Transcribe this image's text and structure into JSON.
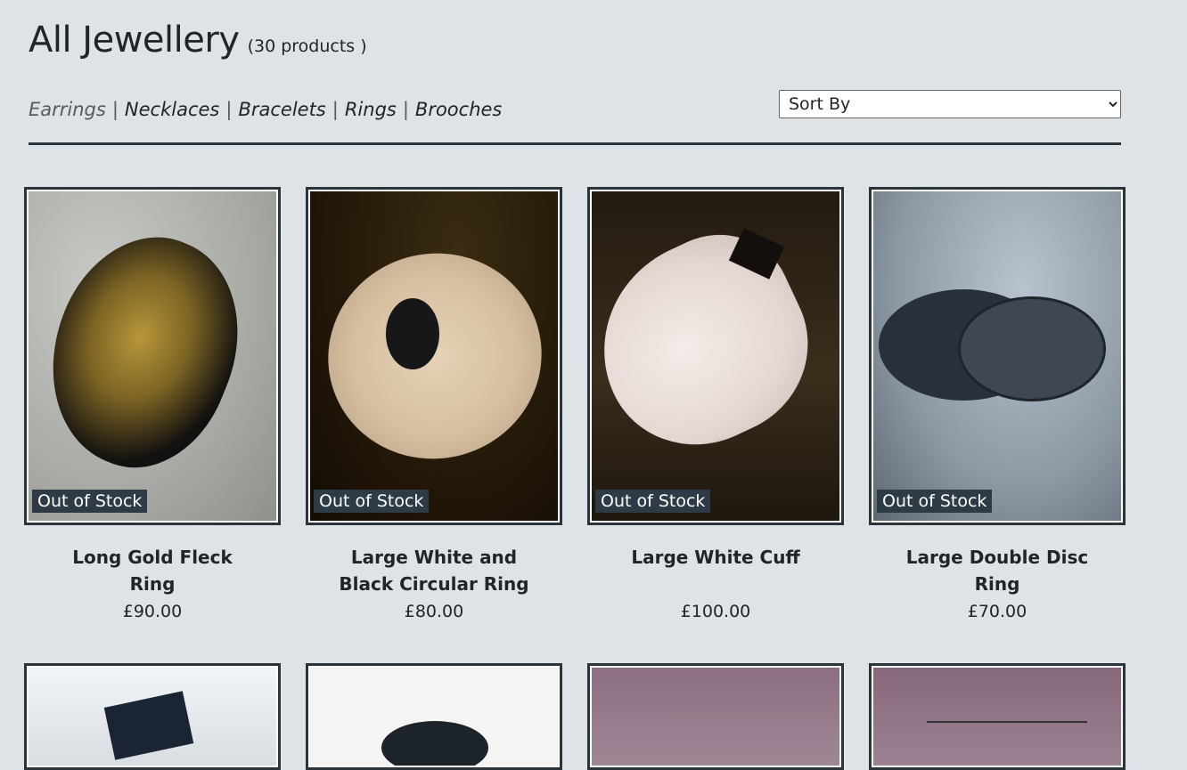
{
  "header": {
    "title": "All Jewellery",
    "count": "(30 products )"
  },
  "categories": [
    {
      "label": "Earrings",
      "active": true
    },
    {
      "label": "Necklaces",
      "active": false
    },
    {
      "label": "Bracelets",
      "active": false
    },
    {
      "label": "Rings",
      "active": false
    },
    {
      "label": "Brooches",
      "active": false
    }
  ],
  "category_separator": "|",
  "sort": {
    "selected": "Sort By"
  },
  "products": [
    {
      "name": "Long Gold Fleck Ring",
      "price": "£90.00",
      "badge": "Out of Stock"
    },
    {
      "name": "Large White and Black Circular Ring",
      "price": "£80.00",
      "badge": "Out of Stock"
    },
    {
      "name": "Large White Cuff",
      "price": "£100.00",
      "badge": "Out of Stock"
    },
    {
      "name": "Large Double Disc Ring",
      "price": "£70.00",
      "badge": "Out of Stock"
    }
  ],
  "colors": {
    "background": "#dde3e7",
    "text": "#212529",
    "border": "#2b333b",
    "badge_bg": "#2e3a45"
  }
}
